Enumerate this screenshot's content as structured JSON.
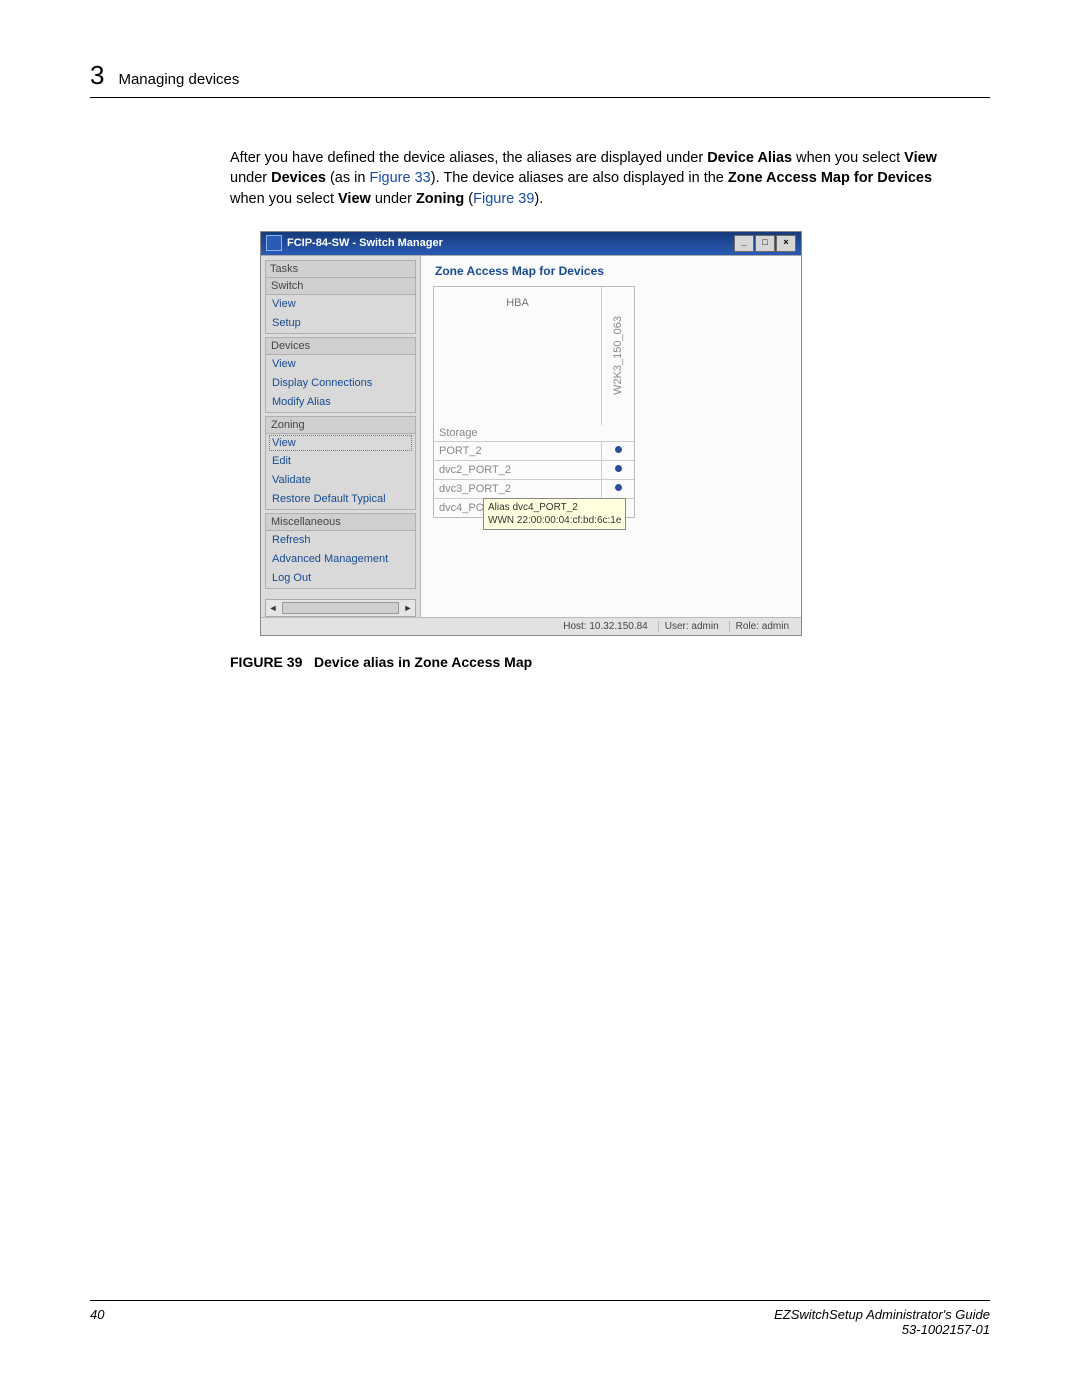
{
  "header": {
    "chapter_num": "3",
    "chapter_title": "Managing devices"
  },
  "body": {
    "p1_a": "After you have defined the device aliases, the aliases are displayed under ",
    "p1_b": "Device Alias",
    "p1_c": " when you select ",
    "p1_d": "View",
    "p1_e": " under ",
    "p1_f": "Devices",
    "p1_g": " (as in ",
    "p1_link1": "Figure 33",
    "p1_h": "). The device aliases are also displayed in the ",
    "p1_i": "Zone Access Map for Devices",
    "p1_j": " when you select ",
    "p1_k": "View",
    "p1_l": " under ",
    "p1_m": "Zoning",
    "p1_n": " (",
    "p1_link2": "Figure 39",
    "p1_o": ")."
  },
  "window": {
    "title": "FCIP-84-SW - Switch Manager",
    "tasks_label": "Tasks",
    "groups": {
      "switch": {
        "header": "Switch",
        "items": [
          "View",
          "Setup"
        ]
      },
      "devices": {
        "header": "Devices",
        "items": [
          "View",
          "Display Connections",
          "Modify Alias"
        ]
      },
      "zoning": {
        "header": "Zoning",
        "items": [
          "View",
          "Edit",
          "Validate",
          "Restore Default Typical"
        ]
      },
      "misc": {
        "header": "Miscellaneous",
        "items": [
          "Refresh",
          "Advanced Management",
          "Log Out"
        ]
      }
    },
    "panel_title": "Zone Access Map for Devices",
    "col_hba": "HBA",
    "col_vertical": "W2K3_150_063",
    "storage_label": "Storage",
    "rows": [
      "PORT_2",
      "dvc2_PORT_2",
      "dvc3_PORT_2",
      "dvc4_PORT_2"
    ],
    "tooltip_line1": "Alias  dvc4_PORT_2",
    "tooltip_line2": "WWN  22:00:00:04:cf:bd:6c:1e",
    "status": {
      "host": "Host: 10.32.150.84",
      "user": "User: admin",
      "role": "Role: admin"
    }
  },
  "figure": {
    "label": "FIGURE 39",
    "gap": "   ",
    "caption": "Device alias in Zone Access Map"
  },
  "footer": {
    "page": "40",
    "doc_title": "EZSwitchSetup Administrator's Guide",
    "doc_num": "53-1002157-01"
  }
}
